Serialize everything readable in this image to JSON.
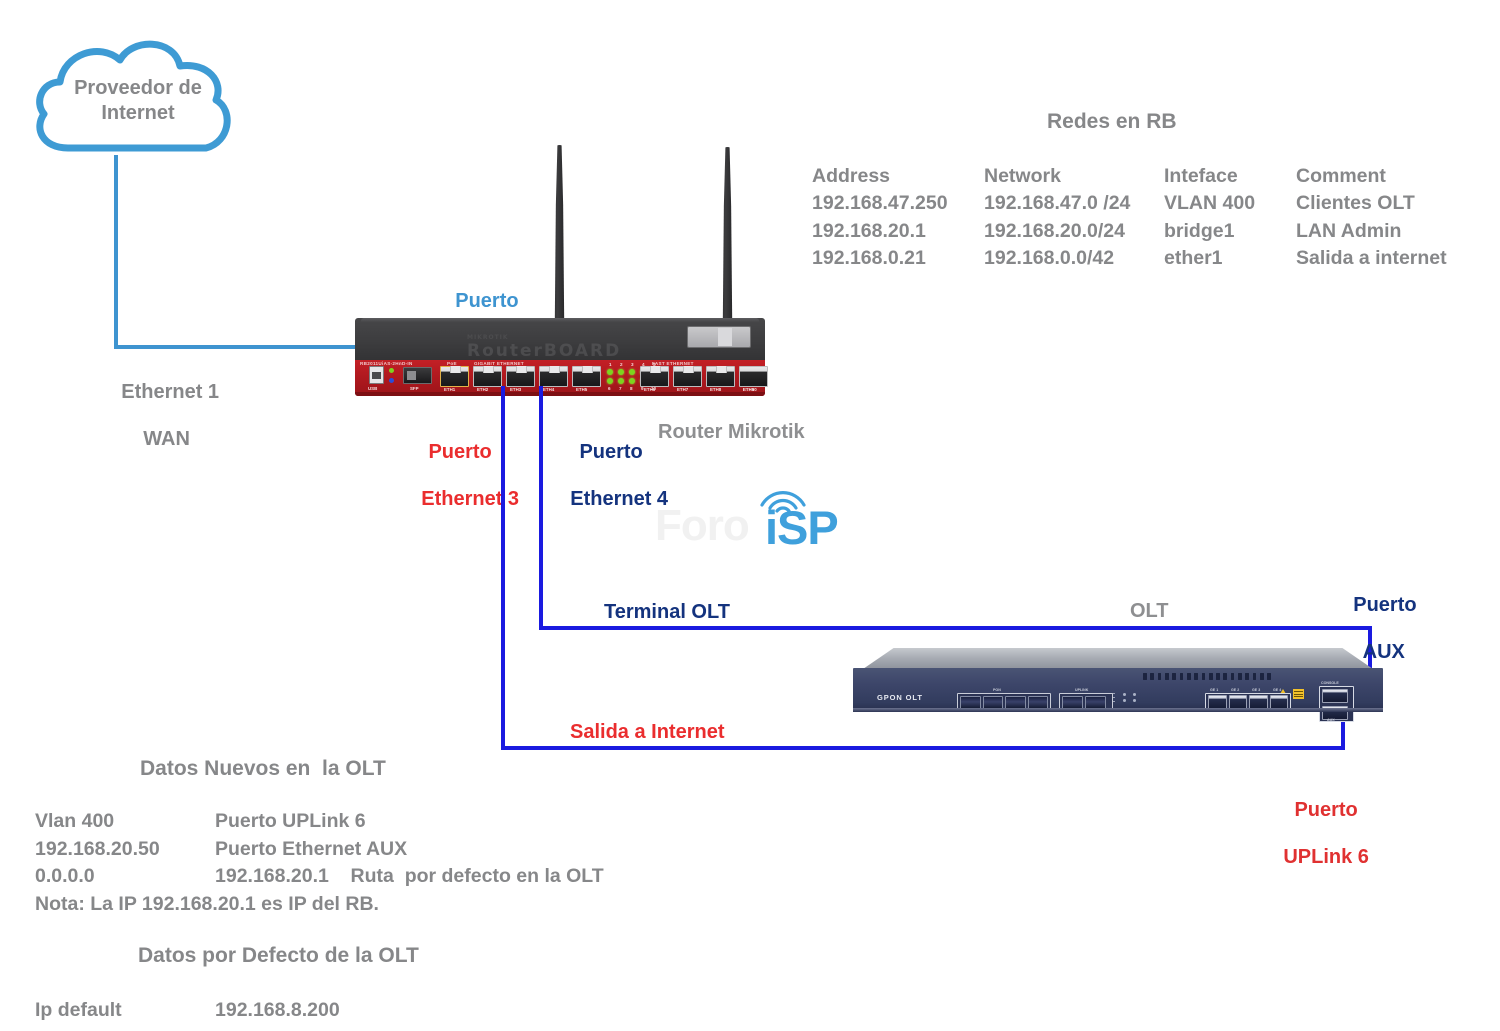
{
  "colors": {
    "blue_light": "#3e94d0",
    "blue_navy": "#14337e",
    "line_blue": "#1a1ae0",
    "red": "#ea2d2e",
    "gray_text": "#868789",
    "router_red": "#b0191f",
    "olt_blue": "#3d466a"
  },
  "cloud": {
    "name": "cloud-icon",
    "label_line1": "Proveedor de",
    "label_line2": "Internet"
  },
  "wan": {
    "label_line1": "Ethernet 1",
    "label_line2": "WAN"
  },
  "router": {
    "device_label": "Router Mikrotik",
    "brand": "MIKROTIK",
    "brand_sub": "RouterBOARD",
    "model_silk": "RB2011UiAS-2HnD-IN",
    "section_gigabit": "GIGABIT ETHERNET",
    "section_fast": "FAST ETHERNET",
    "poe_silk": "PoE",
    "sfp_silk": "SFP",
    "usb_silk": "USB",
    "ports": [
      "ETH1",
      "ETH2",
      "ETH3",
      "ETH4",
      "ETH5",
      "ETH6",
      "ETH7",
      "ETH8",
      "ETH9",
      "ETH10"
    ],
    "led_numbers_top": [
      "1",
      "2",
      "3",
      "4",
      "5"
    ],
    "led_numbers_bottom": [
      "6",
      "7",
      "8",
      "9",
      "10"
    ],
    "callout_eth1_line1": "Puerto",
    "callout_eth1_line2": "Ethernet 1",
    "callout_eth3_line1": "Puerto",
    "callout_eth3_line2": "Ethernet 3",
    "callout_eth4_line1": "Puerto",
    "callout_eth4_line2": "Ethernet 4"
  },
  "olt": {
    "device_label": "OLT",
    "brand_silk": "GPON OLT",
    "terminal_label": "Terminal OLT",
    "internet_label": "Salida a Internet",
    "aux_line1": "Puerto",
    "aux_line2": "AUX",
    "uplink_line1": "Puerto",
    "uplink_line2": "UPLink 6",
    "pon_silk": "PON",
    "uplink_silk": "UPLINK",
    "eth_silk": [
      "GE 1",
      "GE 2",
      "GE 3",
      "GE 4"
    ],
    "aux_silk_top": "CONSOLE",
    "aux_silk_bottom": "AUX"
  },
  "watermark": {
    "text_gray": "Foro",
    "text_blue": "iSP"
  },
  "networks_table": {
    "title": "Redes en RB",
    "headers": [
      "Address",
      "Network",
      "Inteface",
      "Comment"
    ],
    "rows": [
      [
        "192.168.47.250",
        "192.168.47.0 /24",
        "VLAN 400",
        "Clientes OLT"
      ],
      [
        "192.168.20.1",
        "192.168.20.0/24",
        "bridge1",
        "LAN Admin"
      ],
      [
        "192.168.0.21",
        "192.168.0.0/42",
        "ether1",
        "Salida a internet"
      ]
    ]
  },
  "olt_new_data": {
    "title": "Datos Nuevos en  la OLT",
    "rows": [
      [
        "Vlan 400",
        "Puerto UPLink 6"
      ],
      [
        "192.168.20.50",
        "Puerto Ethernet AUX"
      ],
      [
        "0.0.0.0",
        "192.168.20.1    Ruta  por defecto en la OLT"
      ]
    ],
    "note": "Nota: La IP 192.168.20.1 es IP del RB."
  },
  "olt_default_data": {
    "title": "Datos por Defecto de la OLT",
    "rows": [
      [
        "Ip default",
        "192.168.8.200"
      ]
    ]
  }
}
